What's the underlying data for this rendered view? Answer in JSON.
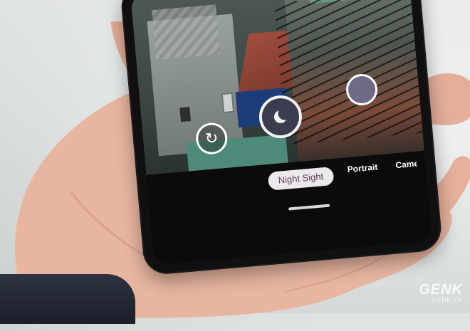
{
  "camera_ui": {
    "active_mode": "Night Sight",
    "other_modes": [
      "Portrait",
      "Camer"
    ],
    "controls": {
      "switch_camera_icon": "switch-camera-icon",
      "shutter_icon": "night-sight-moon-icon",
      "gallery_thumbnail": "gallery-thumbnail"
    }
  },
  "watermark": {
    "brand": "GENK",
    "site": "GENK.VN"
  },
  "colors": {
    "pill_bg": "#ece8ec",
    "pill_text": "#5b3f55",
    "shutter": "#3a3d4e",
    "gallery": "#6f6a86"
  }
}
